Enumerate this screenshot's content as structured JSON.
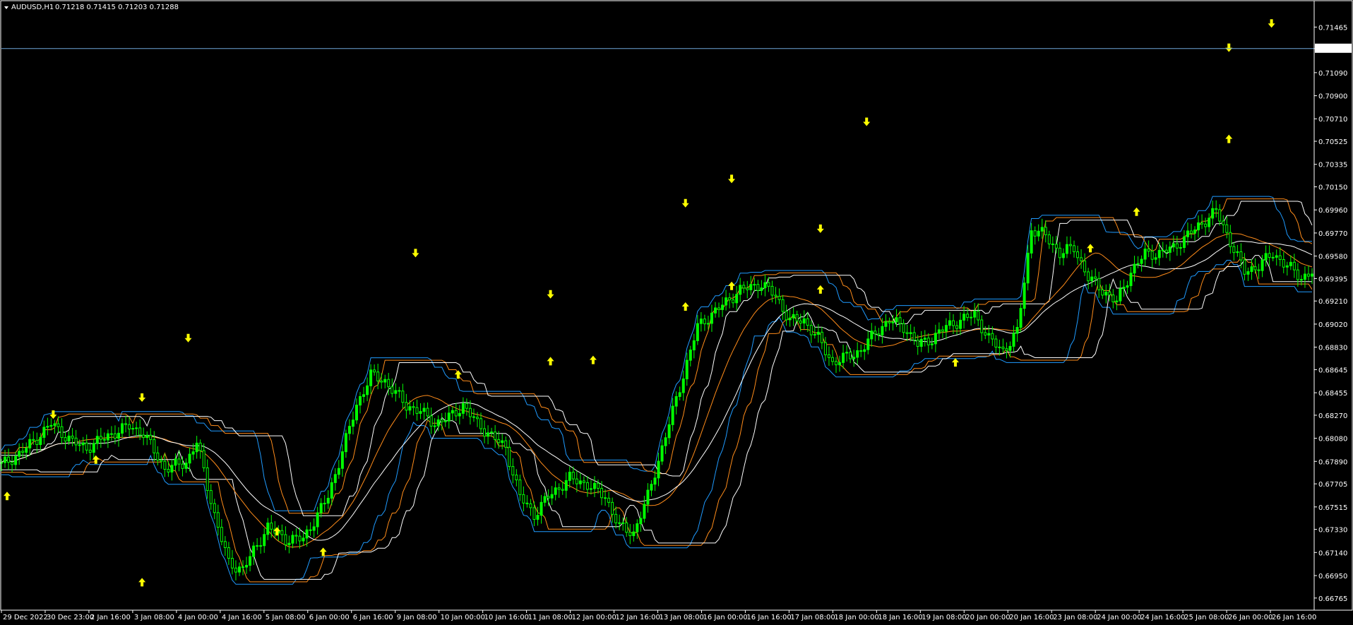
{
  "header": {
    "symbol": "AUDUSD,H1",
    "ohlc": "0.71218 0.71415 0.71203 0.71288"
  },
  "colors": {
    "background": "#000000",
    "bull_candle": "#00ff00",
    "bear_candle": "#00ff00",
    "outer_band_blue": "#1f9bff",
    "mid_band_orange": "#ff8c1a",
    "inner_band_white": "#ffffff",
    "arrow_yellow": "#ffff00",
    "price_line": "#6ea5d9",
    "frame": "#ffffff"
  },
  "chart_data": {
    "type": "candlestick",
    "y_ticks": [
      "0.71465",
      "0.71288",
      "0.71090",
      "0.70900",
      "0.70710",
      "0.70525",
      "0.70335",
      "0.70150",
      "0.69960",
      "0.69770",
      "0.69580",
      "0.69395",
      "0.69210",
      "0.69020",
      "0.68830",
      "0.68645",
      "0.68455",
      "0.68270",
      "0.68080",
      "0.67890",
      "0.67705",
      "0.67515",
      "0.67330",
      "0.67140",
      "0.66950",
      "0.66765"
    ],
    "ylim": [
      0.667,
      0.7156
    ],
    "current_price": 0.71288,
    "x_labels": [
      "29 Dec 2022",
      "30 Dec 23:00",
      "2 Jan 16:00",
      "3 Jan 08:00",
      "4 Jan 00:00",
      "4 Jan 16:00",
      "5 Jan 08:00",
      "6 Jan 00:00",
      "6 Jan 16:00",
      "9 Jan 08:00",
      "10 Jan 00:00",
      "10 Jan 16:00",
      "11 Jan 08:00",
      "12 Jan 00:00",
      "12 Jan 16:00",
      "13 Jan 08:00",
      "16 Jan 00:00",
      "16 Jan 16:00",
      "17 Jan 08:00",
      "18 Jan 00:00",
      "18 Jan 16:00",
      "19 Jan 08:00",
      "20 Jan 00:00",
      "20 Jan 16:00",
      "23 Jan 08:00",
      "24 Jan 00:00",
      "24 Jan 16:00",
      "25 Jan 08:00",
      "26 Jan 00:00",
      "26 Jan 16:00"
    ],
    "bars_count": 370,
    "price_path": [
      [
        0,
        0.6786
      ],
      [
        5,
        0.6795
      ],
      [
        10,
        0.6808
      ],
      [
        14,
        0.682
      ],
      [
        20,
        0.6805
      ],
      [
        24,
        0.68
      ],
      [
        30,
        0.681
      ],
      [
        36,
        0.6818
      ],
      [
        40,
        0.6812
      ],
      [
        46,
        0.6783
      ],
      [
        52,
        0.6788
      ],
      [
        55,
        0.6805
      ],
      [
        60,
        0.6745
      ],
      [
        64,
        0.6705
      ],
      [
        68,
        0.67
      ],
      [
        75,
        0.6735
      ],
      [
        80,
        0.6725
      ],
      [
        85,
        0.6725
      ],
      [
        92,
        0.676
      ],
      [
        100,
        0.6835
      ],
      [
        104,
        0.686
      ],
      [
        108,
        0.6855
      ],
      [
        114,
        0.6835
      ],
      [
        118,
        0.683
      ],
      [
        122,
        0.682
      ],
      [
        126,
        0.6825
      ],
      [
        130,
        0.6835
      ],
      [
        134,
        0.682
      ],
      [
        138,
        0.681
      ],
      [
        142,
        0.68
      ],
      [
        146,
        0.676
      ],
      [
        150,
        0.6745
      ],
      [
        154,
        0.676
      ],
      [
        160,
        0.6775
      ],
      [
        165,
        0.677
      ],
      [
        170,
        0.676
      ],
      [
        174,
        0.6735
      ],
      [
        178,
        0.673
      ],
      [
        182,
        0.676
      ],
      [
        186,
        0.68
      ],
      [
        192,
        0.686
      ],
      [
        196,
        0.69
      ],
      [
        204,
        0.692
      ],
      [
        208,
        0.693
      ],
      [
        214,
        0.6935
      ],
      [
        218,
        0.6925
      ],
      [
        222,
        0.6905
      ],
      [
        226,
        0.6905
      ],
      [
        230,
        0.689
      ],
      [
        234,
        0.687
      ],
      [
        238,
        0.6875
      ],
      [
        242,
        0.688
      ],
      [
        246,
        0.6895
      ],
      [
        250,
        0.6905
      ],
      [
        254,
        0.69
      ],
      [
        258,
        0.6885
      ],
      [
        262,
        0.689
      ],
      [
        266,
        0.69
      ],
      [
        270,
        0.6905
      ],
      [
        274,
        0.691
      ],
      [
        278,
        0.689
      ],
      [
        282,
        0.688
      ],
      [
        286,
        0.6895
      ],
      [
        290,
        0.698
      ],
      [
        294,
        0.6975
      ],
      [
        298,
        0.696
      ],
      [
        302,
        0.6965
      ],
      [
        306,
        0.694
      ],
      [
        310,
        0.693
      ],
      [
        314,
        0.692
      ],
      [
        318,
        0.6945
      ],
      [
        322,
        0.696
      ],
      [
        326,
        0.696
      ],
      [
        330,
        0.6965
      ],
      [
        334,
        0.6975
      ],
      [
        338,
        0.6985
      ],
      [
        342,
        0.6995
      ],
      [
        346,
        0.697
      ],
      [
        350,
        0.6945
      ],
      [
        354,
        0.695
      ],
      [
        358,
        0.696
      ],
      [
        362,
        0.695
      ],
      [
        366,
        0.694
      ],
      [
        369,
        0.6945
      ]
    ],
    "up_arrows": [
      {
        "x": "29 Dec",
        "y": 0.6764
      },
      {
        "x": "2 Jan",
        "y": 0.6794
      },
      {
        "x": "3 Jan",
        "y": 0.6693
      },
      {
        "x": "5 Jan",
        "y": 0.6735
      },
      {
        "x": "6 Jan",
        "y": 0.6718
      },
      {
        "x": "10 Jan",
        "y": 0.6864
      },
      {
        "x": "11 Jan",
        "y": 0.6875
      },
      {
        "x": "12 Jan",
        "y": 0.6876
      },
      {
        "x": "13 Jan",
        "y": 0.692
      },
      {
        "x": "16 Jan",
        "y": 0.6937
      },
      {
        "x": "17 Jan",
        "y": 0.6934
      },
      {
        "x": "19 Jan",
        "y": 0.6874
      },
      {
        "x": "23 Jan",
        "y": 0.6968
      },
      {
        "x": "24 Jan",
        "y": 0.6998
      },
      {
        "x": "25 Jan",
        "y": 0.7058
      }
    ],
    "down_arrows": [
      {
        "x": "30 Dec",
        "y": 0.6824
      },
      {
        "x": "3 Jan",
        "y": 0.6838
      },
      {
        "x": "4 Jan",
        "y": 0.6887
      },
      {
        "x": "9 Jan",
        "y": 0.6957
      },
      {
        "x": "11 Jan",
        "y": 0.6923
      },
      {
        "x": "13 Jan",
        "y": 0.6998
      },
      {
        "x": "16 Jan",
        "y": 0.7018
      },
      {
        "x": "17 Jan",
        "y": 0.6977
      },
      {
        "x": "18 Jan",
        "y": 0.7065
      },
      {
        "x": "25 Jan",
        "y": 0.7126
      },
      {
        "x": "26 Jan",
        "y": 0.7146
      }
    ]
  }
}
